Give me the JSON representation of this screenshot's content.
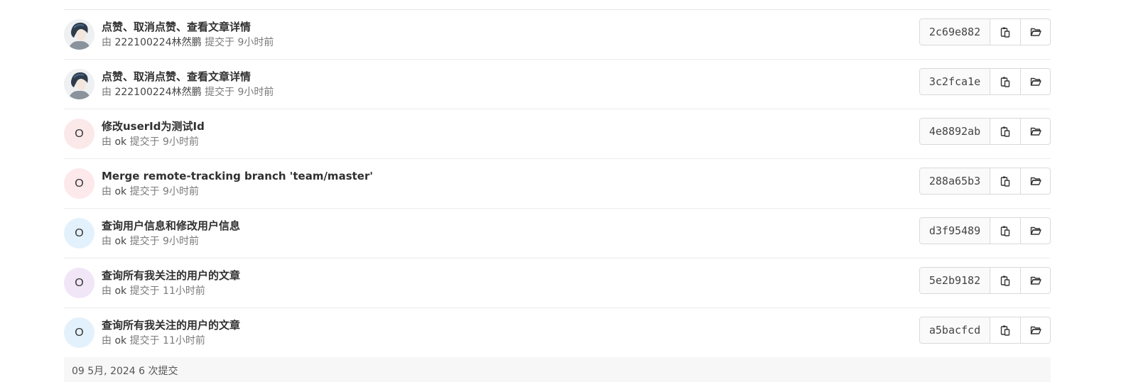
{
  "commits": [
    {
      "title": "点赞、取消点赞、查看文章详情",
      "by": "由",
      "author": "222100224林然鹏",
      "submitted": "提交于 9小时前",
      "sha": "2c69e882",
      "avatar": "photo",
      "avatar_bg": "#f3f3f3"
    },
    {
      "title": "点赞、取消点赞、查看文章详情",
      "by": "由",
      "author": "222100224林然鹏",
      "submitted": "提交于 9小时前",
      "sha": "3c2fca1e",
      "avatar": "photo",
      "avatar_bg": "#f3f3f3"
    },
    {
      "title": "修改userId为测试Id",
      "by": "由",
      "author": "ok",
      "submitted": "提交于 9小时前",
      "sha": "4e8892ab",
      "avatar": "O",
      "avatar_bg": "#fbe9e9"
    },
    {
      "title": "Merge remote-tracking branch 'team/master'",
      "by": "由",
      "author": "ok",
      "submitted": "提交于 9小时前",
      "sha": "288a65b3",
      "avatar": "O",
      "avatar_bg": "#fde8ec"
    },
    {
      "title": "查询用户信息和修改用户信息",
      "by": "由",
      "author": "ok",
      "submitted": "提交于 9小时前",
      "sha": "d3f95489",
      "avatar": "O",
      "avatar_bg": "#e3f1fc"
    },
    {
      "title": "查询所有我关注的用户的文章",
      "by": "由",
      "author": "ok",
      "submitted": "提交于 11小时前",
      "sha": "5e2b9182",
      "avatar": "O",
      "avatar_bg": "#f1e6f7"
    },
    {
      "title": "查询所有我关注的用户的文章",
      "by": "由",
      "author": "ok",
      "submitted": "提交于 11小时前",
      "sha": "a5bacfcd",
      "avatar": "O",
      "avatar_bg": "#e3f1fc"
    }
  ],
  "icons": {
    "copy": "copy-icon",
    "browse": "folder-open-icon"
  },
  "footer": {
    "label": "09 5月, 2024 6 次提交"
  }
}
